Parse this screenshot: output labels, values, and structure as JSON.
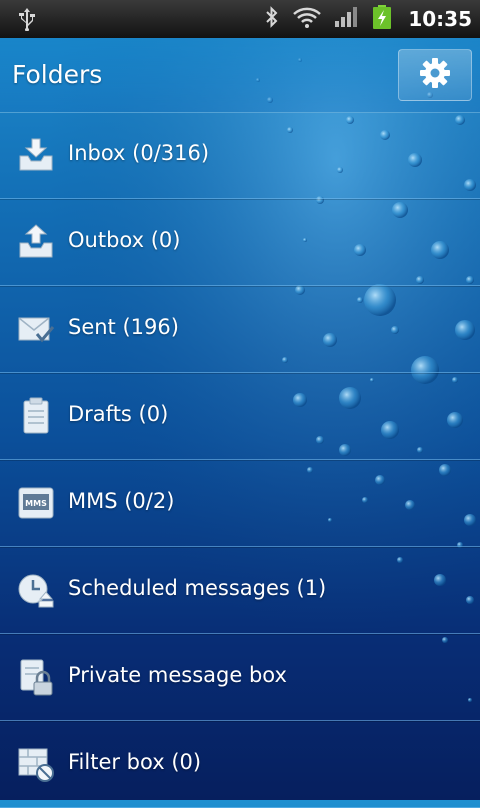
{
  "status_bar": {
    "time": "10:35",
    "icons": [
      "usb-icon",
      "bluetooth-icon",
      "wifi-icon",
      "signal-icon",
      "battery-charging-icon"
    ]
  },
  "header": {
    "title": "Folders",
    "settings_icon": "gear-icon"
  },
  "folders": [
    {
      "label": "Inbox (0/316)",
      "icon": "inbox-icon"
    },
    {
      "label": "Outbox (0)",
      "icon": "outbox-icon"
    },
    {
      "label": "Sent (196)",
      "icon": "sent-icon"
    },
    {
      "label": "Drafts (0)",
      "icon": "drafts-icon"
    },
    {
      "label": "MMS (0/2)",
      "icon": "mms-icon"
    },
    {
      "label": "Scheduled messages (1)",
      "icon": "scheduled-icon"
    },
    {
      "label": "Private message box",
      "icon": "private-box-icon"
    },
    {
      "label": "Filter box (0)",
      "icon": "filter-box-icon"
    }
  ],
  "mms_icon_text": "MMS",
  "colors": {
    "status_bar": "#1a1a1a",
    "background_top": "#1f8fd0",
    "background_bottom": "#061f5e",
    "divider": "#78bef0",
    "text": "#ffffff"
  }
}
